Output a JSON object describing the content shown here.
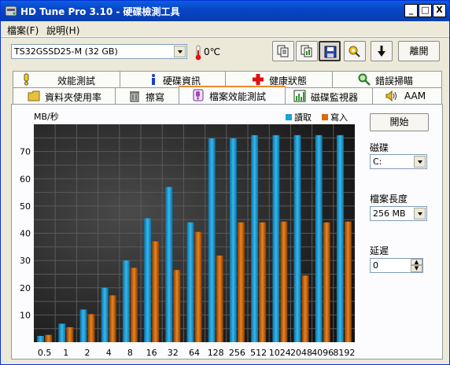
{
  "window": {
    "title": "HD Tune Pro 3.10 - 硬碟檢測工具",
    "controls": {
      "minimize": "_",
      "maximize": "□",
      "close": "X"
    }
  },
  "menu": [
    {
      "label": "檔案(F)"
    },
    {
      "label": "說明(H)"
    }
  ],
  "drive_select": {
    "value": "TS32GSSD25-M (32 GB)"
  },
  "temperature": "0℃",
  "toolbar": {
    "exit_label": "離開",
    "icons": [
      "copy-text-icon",
      "copy-screenshot-icon",
      "save-icon",
      "options-icon",
      "download-icon"
    ]
  },
  "tabs_row1": [
    {
      "label": "效能測試",
      "icon": "benchmark-icon"
    },
    {
      "label": "硬碟資訊",
      "icon": "info-icon"
    },
    {
      "label": "健康狀態",
      "icon": "health-icon"
    },
    {
      "label": "錯誤掃瞄",
      "icon": "error-scan-icon"
    }
  ],
  "tabs_row2": [
    {
      "label": "資料夾使用率",
      "icon": "folder-icon"
    },
    {
      "label": "擦寫",
      "icon": "erase-icon"
    },
    {
      "label": "檔案效能測試",
      "icon": "file-benchmark-icon",
      "active": true
    },
    {
      "label": "磁碟監視器",
      "icon": "disk-monitor-icon"
    },
    {
      "label": "AAM",
      "icon": "speaker-icon"
    }
  ],
  "side_panel": {
    "start_label": "開始",
    "drive_label": "磁碟",
    "drive_value": "C:",
    "file_length_label": "檔案長度",
    "file_length_value": "256 MB",
    "delay_label": "延遲",
    "delay_value": "0"
  },
  "chart_data": {
    "type": "bar",
    "ylabel": "MB/秒",
    "ylim": [
      0,
      80
    ],
    "yticks": [
      10,
      20,
      30,
      40,
      50,
      60,
      70
    ],
    "categories": [
      "0.5",
      "1",
      "2",
      "4",
      "8",
      "16",
      "32",
      "64",
      "128",
      "256",
      "512",
      "1024",
      "2048",
      "4096",
      "8192"
    ],
    "series": [
      {
        "name": "讀取",
        "color": "#1ea0d8",
        "values": [
          2.3,
          6.8,
          12,
          20,
          30,
          45.5,
          57,
          44,
          74.8,
          74.8,
          76,
          76,
          76,
          76,
          76
        ]
      },
      {
        "name": "寫入",
        "color": "#d66c0c",
        "values": [
          2.7,
          5.5,
          10.3,
          17.2,
          27.3,
          37,
          26.5,
          40.5,
          31.8,
          44,
          44,
          44.3,
          24.5,
          44,
          44.3
        ]
      }
    ],
    "legend": "top-right",
    "grid": true
  }
}
